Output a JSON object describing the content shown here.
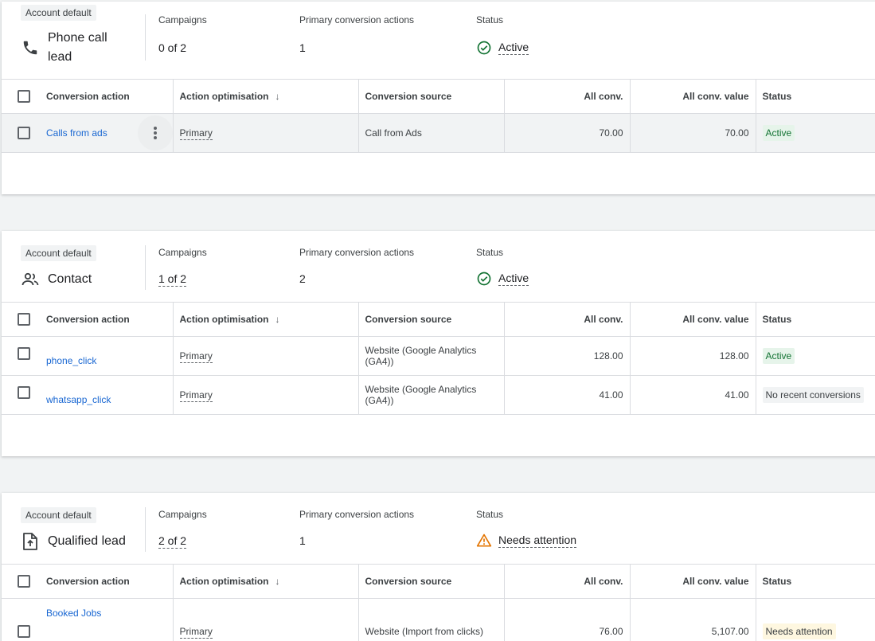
{
  "header_labels": {
    "badge": "Account default",
    "campaigns": "Campaigns",
    "primary_actions": "Primary conversion actions",
    "status": "Status"
  },
  "columns": {
    "action": "Conversion action",
    "optimisation": "Action optimisation",
    "source": "Conversion source",
    "all_conv": "All conv.",
    "all_conv_value": "All conv. value",
    "status": "Status"
  },
  "cards": [
    {
      "goal_line1": "Phone call",
      "goal_line2": "lead",
      "goal_icon": "phone-icon",
      "campaigns": "0 of 2",
      "primary_actions": "1",
      "status": "Active",
      "status_icon": "check-circle-icon",
      "rows": [
        {
          "action": "Calls from ads",
          "optimisation": "Primary",
          "source": "Call from Ads",
          "all_conv": "70.00",
          "all_conv_value": "70.00",
          "status": "Active"
        }
      ]
    },
    {
      "goal": "Contact",
      "goal_icon": "people-icon",
      "campaigns": "1 of 2",
      "primary_actions": "2",
      "status": "Active",
      "status_icon": "check-circle-icon",
      "rows": [
        {
          "action": "phone_click",
          "optimisation": "Primary",
          "source": "Website (Google Analytics (GA4))",
          "all_conv": "128.00",
          "all_conv_value": "128.00",
          "status": "Active"
        },
        {
          "action": "whatsapp_click",
          "optimisation": "Primary",
          "source": "Website (Google Analytics (GA4))",
          "all_conv": "41.00",
          "all_conv_value": "41.00",
          "status": "No recent conversions"
        }
      ]
    },
    {
      "goal": "Qualified lead",
      "goal_icon": "file-upload-icon",
      "campaigns": "2 of 2",
      "primary_actions": "1",
      "status": "Needs attention",
      "status_icon": "warning-icon",
      "rows": [
        {
          "action": "Booked Jobs",
          "optimisation": "Primary",
          "source": "Website (Import from clicks)",
          "all_conv": "76.00",
          "all_conv_value": "5,107.00",
          "status": "Needs attention"
        }
      ]
    }
  ],
  "colors": {
    "active": "#137333",
    "warning": "#e37400",
    "link": "#1967d2"
  }
}
